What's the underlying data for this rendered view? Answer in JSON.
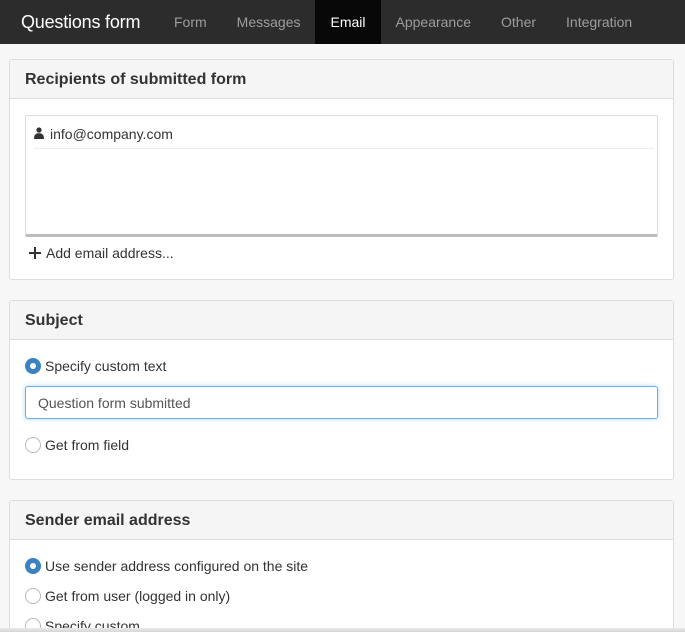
{
  "navbar": {
    "brand": "Questions form",
    "tabs": [
      {
        "label": "Form",
        "active": false
      },
      {
        "label": "Messages",
        "active": false
      },
      {
        "label": "Email",
        "active": true
      },
      {
        "label": "Appearance",
        "active": false
      },
      {
        "label": "Other",
        "active": false
      },
      {
        "label": "Integration",
        "active": false
      }
    ]
  },
  "recipients": {
    "heading": "Recipients of submitted form",
    "items": [
      "info@company.com"
    ],
    "add_label": "Add email address..."
  },
  "subject": {
    "heading": "Subject",
    "options": [
      {
        "label": "Specify custom text",
        "checked": true
      },
      {
        "label": "Get from field",
        "checked": false
      }
    ],
    "custom_text_value": "Question form submitted"
  },
  "sender": {
    "heading": "Sender email address",
    "options": [
      {
        "label": "Use sender address configured on the site",
        "checked": true
      },
      {
        "label": "Get from user (logged in only)",
        "checked": false
      },
      {
        "label": "Specify custom",
        "checked": false
      }
    ]
  },
  "colors": {
    "navbar_bg": "#2c2c2c",
    "active_tab_bg": "#080808",
    "accent": "#3a82c4"
  },
  "icons": {
    "recipient": "user-icon",
    "add": "plus-icon"
  }
}
